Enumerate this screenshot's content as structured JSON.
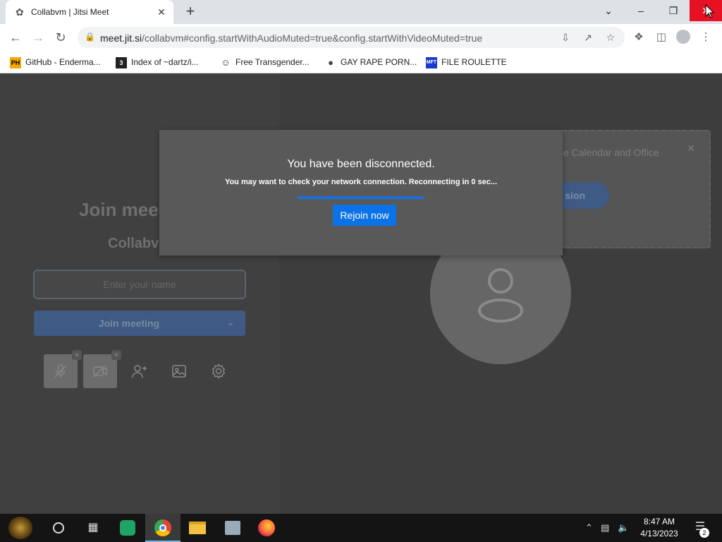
{
  "browser": {
    "tab_title": "Collabvm | Jitsi Meet",
    "url_host": "meet.jit.si",
    "url_path": "/collabvm#config.startWithAudioMuted=true&config.startWithVideoMuted=true"
  },
  "bookmarks": [
    {
      "icon_text": "PH",
      "label": "GitHub - Enderma..."
    },
    {
      "icon_text": "3",
      "label": "Index of ~dartz/i..."
    },
    {
      "icon_text": "",
      "label": "Free Transgender..."
    },
    {
      "icon_text": "",
      "label": "GAY RAPE PORN..."
    },
    {
      "icon_text": "MFT",
      "label": "FILE ROULETTE"
    }
  ],
  "prejoin": {
    "title": "Join mee",
    "room": "Collabv",
    "name_placeholder": "Enter your name",
    "join_label": "Join meeting"
  },
  "notification": {
    "text": "gle Calendar and Office",
    "button_label": "sion"
  },
  "dialog": {
    "title": "You have been disconnected.",
    "message": "You may want to check your network connection. Reconnecting in 0 sec...",
    "progress_fraction": 1.0,
    "rejoin_label": "Rejoin now"
  },
  "taskbar": {
    "time": "8:47 AM",
    "date": "4/13/2023",
    "notification_count": "2"
  },
  "colors": {
    "accent_blue": "#0b72e7",
    "close_red": "#e81123"
  }
}
